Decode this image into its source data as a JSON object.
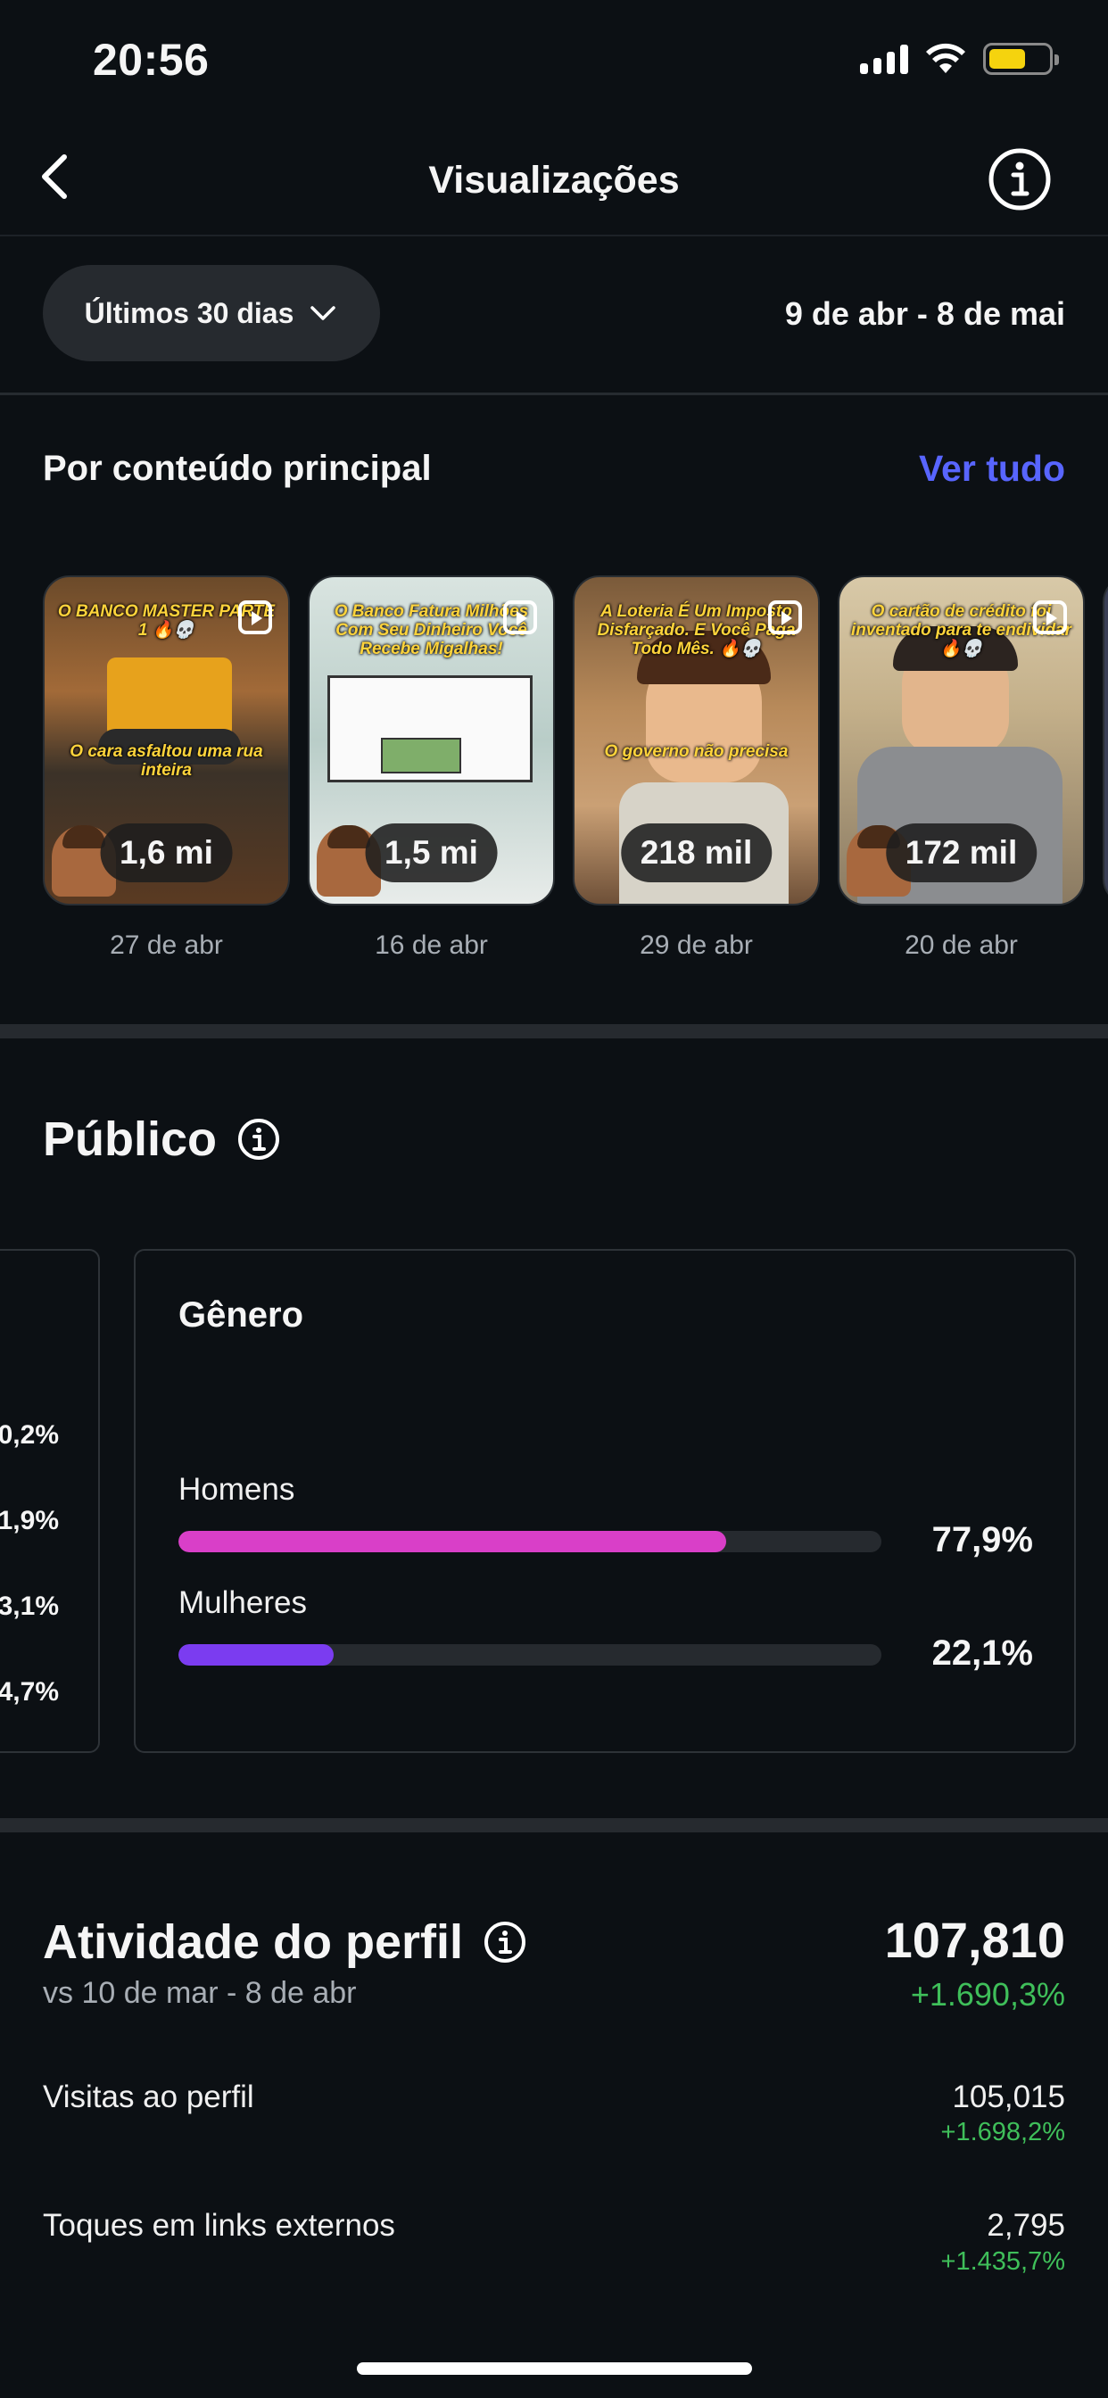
{
  "status_bar": {
    "time": "20:56",
    "battery_color": "#f5d30e"
  },
  "nav": {
    "title": "Visualizações",
    "back_icon": "chevron-left-icon",
    "info_icon": "info-icon"
  },
  "filter": {
    "range_label": "Últimos 30 dias",
    "date_range": "9 de abr - 8 de mai"
  },
  "top_content": {
    "heading": "Por conteúdo principal",
    "see_all": "Ver tudo",
    "items": [
      {
        "caption": "O BANCO MASTER PARTE 1 🔥💀",
        "caption2": "O cara asfaltou uma rua inteira",
        "views": "1,6 mi",
        "date": "27 de abr"
      },
      {
        "caption": "O Banco Fatura Milhões Com Seu Dinheiro Você Recebe Migalhas!",
        "caption2": "",
        "views": "1,5 mi",
        "date": "16 de abr"
      },
      {
        "caption": "A Loteria É Um Imposto Disfarçado. E Você Paga Todo Mês. 🔥💀",
        "caption2": "O governo não precisa",
        "views": "218 mil",
        "date": "29 de abr"
      },
      {
        "caption": "O cartão de crédito foi inventado para te endividar 🔥💀",
        "caption2": "",
        "views": "172 mil",
        "date": "20 de abr"
      }
    ]
  },
  "public": {
    "title": "Público",
    "left_card_values": [
      "0,2%",
      "1,9%",
      "3,1%",
      "4,7%"
    ],
    "gender": {
      "title": "Gênero",
      "rows": [
        {
          "label": "Homens",
          "percent": "77,9%",
          "value": 77.9,
          "color": "#d93fc8"
        },
        {
          "label": "Mulheres",
          "percent": "22,1%",
          "value": 22.1,
          "color": "#7b3cf0"
        }
      ]
    }
  },
  "activity": {
    "title": "Atividade do perfil",
    "subtitle": "vs 10 de mar - 8 de abr",
    "total": "107,810",
    "total_change": "+1.690,3%",
    "rows": [
      {
        "label": "Visitas ao perfil",
        "value": "105,015",
        "change": "+1.698,2%"
      },
      {
        "label": "Toques em links externos",
        "value": "2,795",
        "change": "+1.435,7%"
      }
    ],
    "positive_color": "#3fbf5a"
  },
  "accent_color": "#5865ff"
}
